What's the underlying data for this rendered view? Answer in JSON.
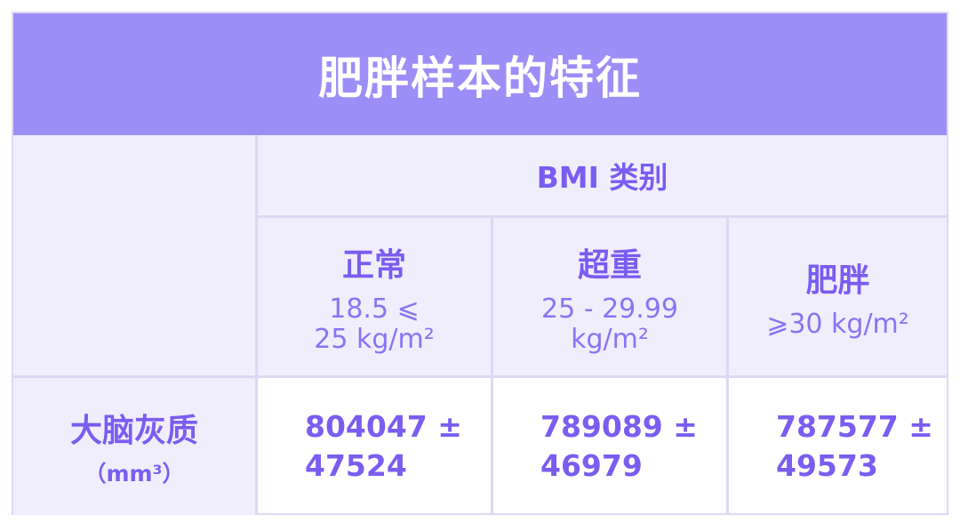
{
  "table": {
    "title": "肥胖样本的特征",
    "bmi_header": "BMI 类别",
    "categories": [
      {
        "name": "正常",
        "range": "18.5 ⩽\n25 kg/m²"
      },
      {
        "name": "超重",
        "range": "25 - 29.99\nkg/m²"
      },
      {
        "name": "肥胖",
        "range": "⩾30 kg/m²"
      }
    ],
    "row": {
      "label": "大脑灰质",
      "unit": "（mm³）",
      "values": [
        "804047 ±\n47524",
        "789089 ±\n46979",
        "787577 ±\n49573"
      ]
    }
  },
  "colors": {
    "title_background": "#9d8ef7",
    "title_text": "#ffffff",
    "cell_background": "#f0eefd",
    "text_accent": "#7a5df0",
    "grid_lines": "#ddd9f3"
  }
}
